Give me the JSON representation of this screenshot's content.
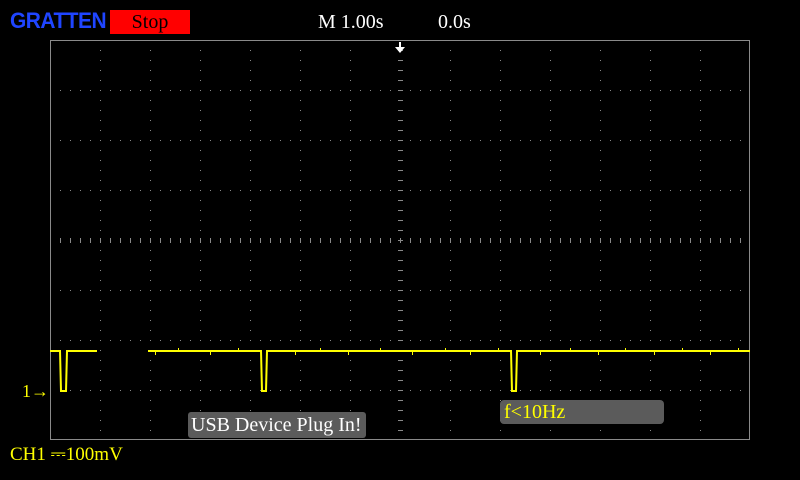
{
  "header": {
    "brand": "GRATTEN",
    "run_state": "Stop",
    "timebase": "M 1.00s",
    "trigger_position": "0.0s"
  },
  "colors": {
    "background": "#000000",
    "grid": "#8a8a8a",
    "trace": "#ffff00",
    "brand": "#1f45ff",
    "run_state_bg": "#ff0000",
    "overlay_bg": "#5b5b5b"
  },
  "icons": {
    "trigger_marker": "triangle-down-icon",
    "channel_ground_marker": "arrow-right-icon"
  },
  "channel": {
    "marker_label": "1→",
    "scale_label": "CH1 ⎓100mV",
    "color": "#ffff00"
  },
  "notices": {
    "usb": "USB Device Plug In!",
    "frequency": "f<10Hz"
  }
}
